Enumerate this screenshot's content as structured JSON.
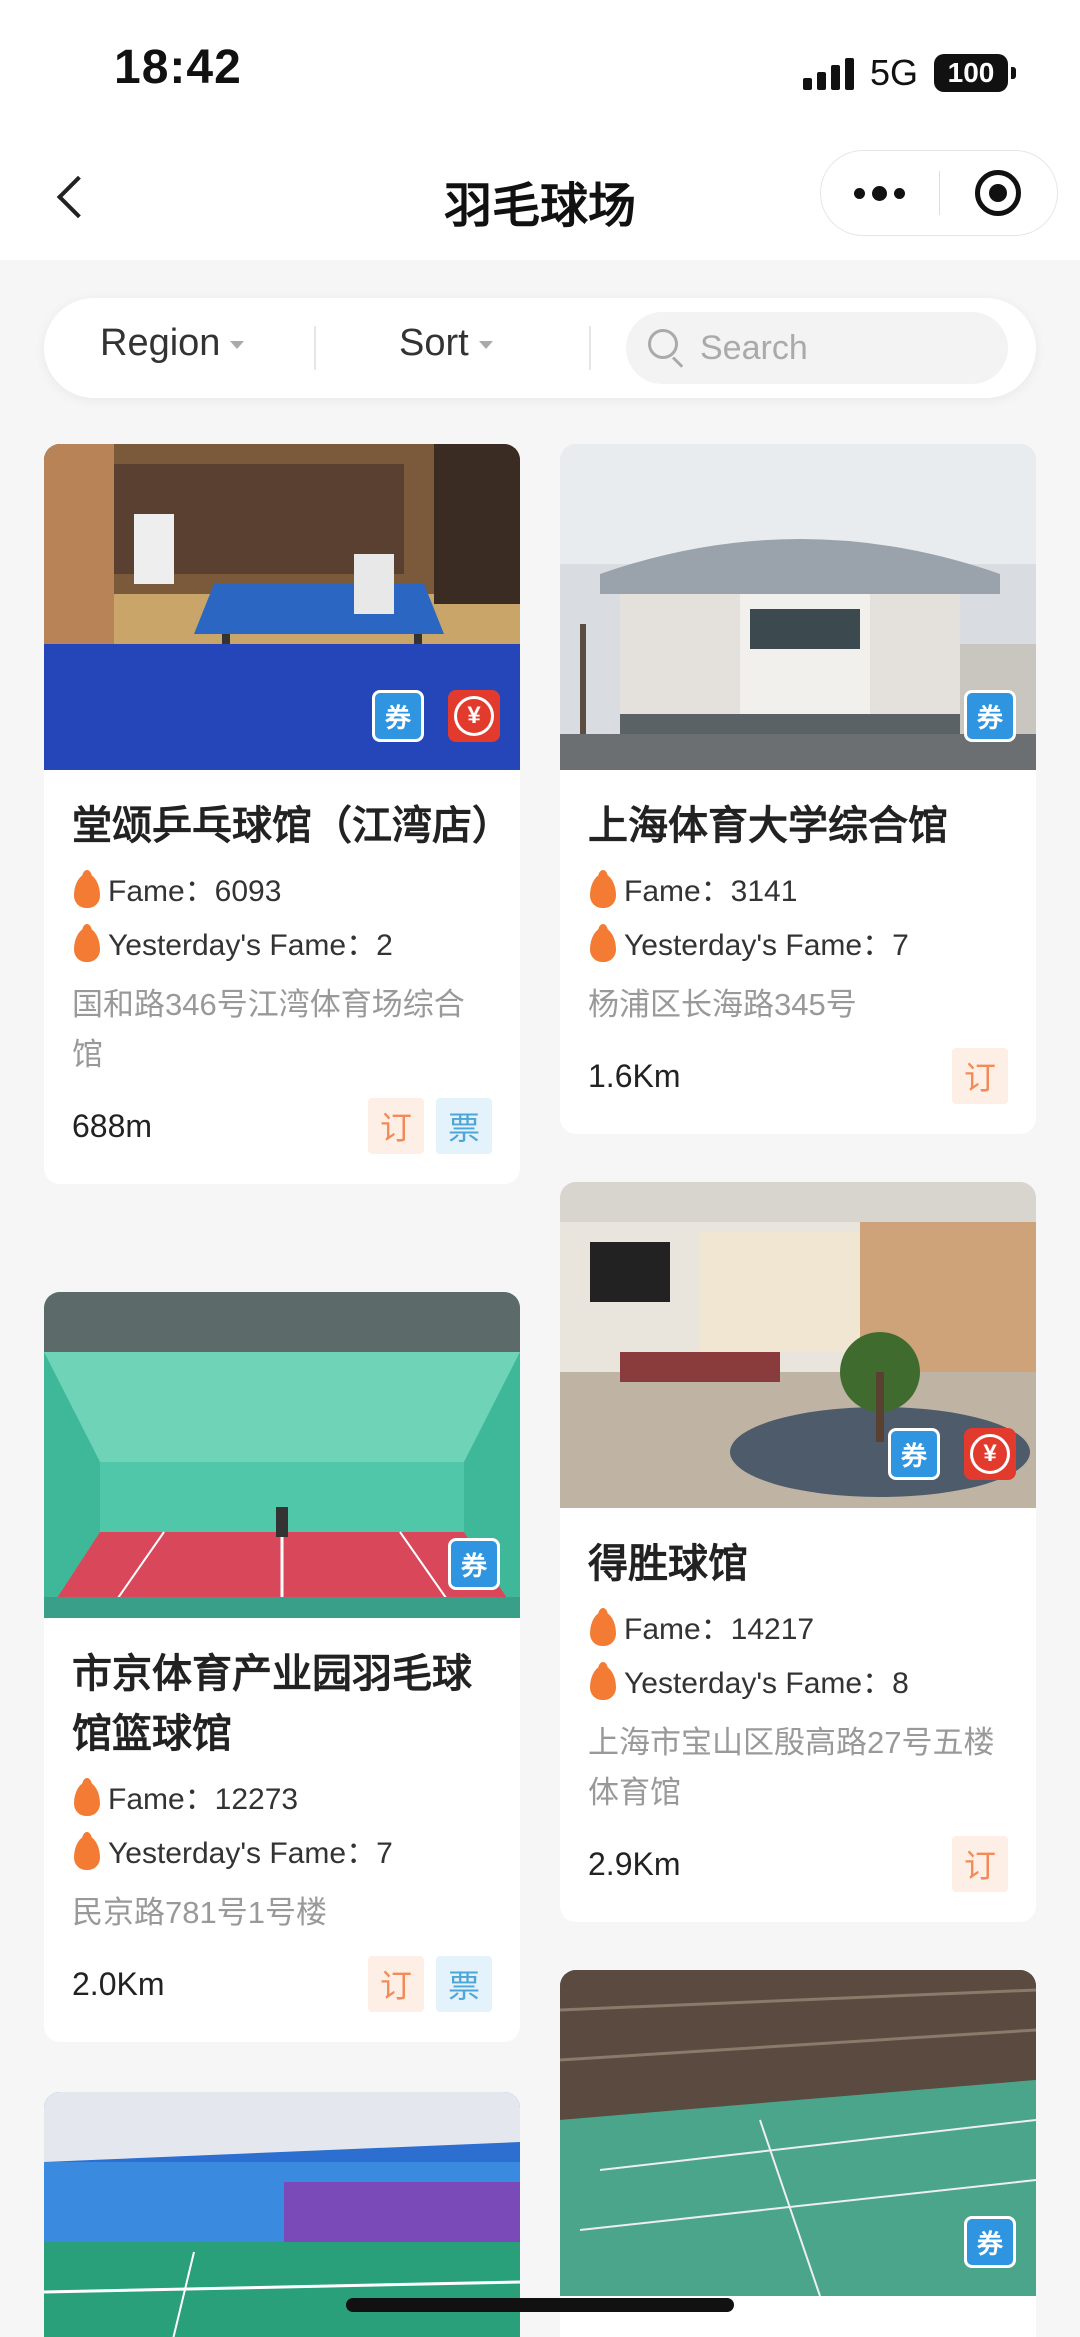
{
  "status_bar": {
    "time": "18:42",
    "network": "5G",
    "battery": "100"
  },
  "nav": {
    "title": "羽毛球场"
  },
  "filters": {
    "region": "Region",
    "sort": "Sort",
    "search_placeholder": "Search"
  },
  "venues": [
    {
      "name": "堂颂乒乓球馆（江湾店）",
      "fame_label": "Fame：6093",
      "yesterday_label": "Yesterday's Fame：2",
      "address": "国和路346号江湾体育场综合馆",
      "distance": "688m",
      "badges": [
        "coupon-icon",
        "yuan-icon"
      ],
      "tags": [
        "订",
        "票"
      ]
    },
    {
      "name": "上海体育大学综合馆",
      "fame_label": "Fame：3141",
      "yesterday_label": "Yesterday's Fame：7",
      "address": "杨浦区长海路345号",
      "distance": "1.6Km",
      "badges": [
        "coupon-icon"
      ],
      "tags": [
        "订"
      ]
    },
    {
      "name": "市京体育产业园羽毛球馆篮球馆",
      "fame_label": "Fame：12273",
      "yesterday_label": "Yesterday's Fame：7",
      "address": "民京路781号1号楼",
      "distance": "2.0Km",
      "badges": [
        "coupon-icon"
      ],
      "tags": [
        "订",
        "票"
      ]
    },
    {
      "name": "得胜球馆",
      "fame_label": "Fame：14217",
      "yesterday_label": "Yesterday's Fame：8",
      "address": "上海市宝山区殷高路27号五楼体育馆",
      "distance": "2.9Km",
      "badges": [
        "coupon-icon",
        "yuan-icon"
      ],
      "tags": [
        "订"
      ]
    }
  ],
  "badge_glyphs": {
    "coupon": "券",
    "yuan": "¥"
  },
  "colors": {
    "flame": "#f47b33",
    "book_tag": "#f28b57",
    "ticket_tag": "#4ea6d8",
    "coupon_badge": "#2f95e0",
    "yuan_badge": "#e23b2e"
  }
}
